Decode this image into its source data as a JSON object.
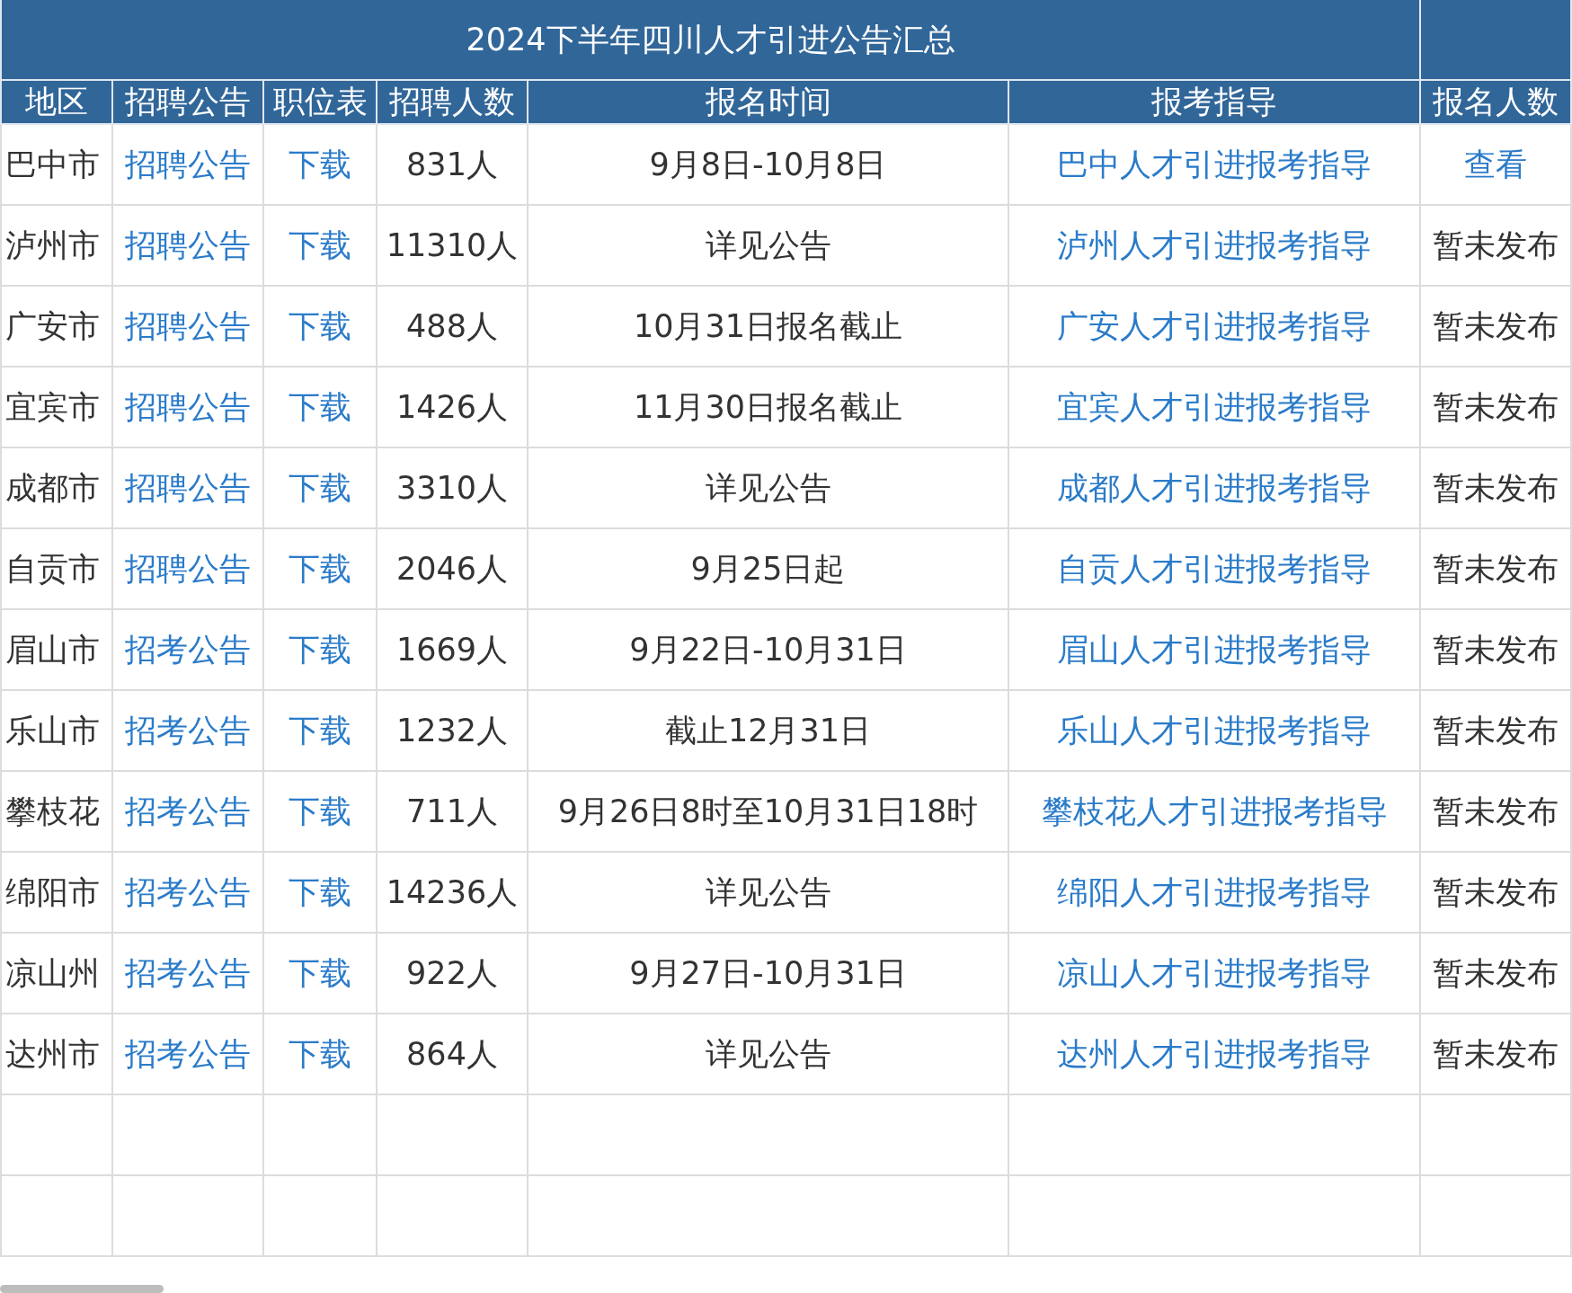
{
  "title": "2024下半年四川人才引进公告汇总",
  "columns": [
    "地区",
    "招聘公告",
    "职位表",
    "招聘人数",
    "报名时间",
    "报考指导",
    "报名人数"
  ],
  "rows": [
    {
      "region": "巴中市",
      "notice": "招聘公告",
      "positions": "下载",
      "count": "831人",
      "period": "9月8日-10月8日",
      "guide": "巴中人才引进报考指导",
      "applicants": {
        "kind": "link",
        "text": "查看"
      }
    },
    {
      "region": "泸州市",
      "notice": "招聘公告",
      "positions": "下载",
      "count": "11310人",
      "period": "详见公告",
      "guide": "泸州人才引进报考指导",
      "applicants": {
        "kind": "text",
        "text": "暂未发布"
      }
    },
    {
      "region": "广安市",
      "notice": "招聘公告",
      "positions": "下载",
      "count": "488人",
      "period": "10月31日报名截止",
      "guide": "广安人才引进报考指导",
      "applicants": {
        "kind": "text",
        "text": "暂未发布"
      }
    },
    {
      "region": "宜宾市",
      "notice": "招聘公告",
      "positions": "下载",
      "count": "1426人",
      "period": "11月30日报名截止",
      "guide": "宜宾人才引进报考指导",
      "applicants": {
        "kind": "text",
        "text": "暂未发布"
      }
    },
    {
      "region": "成都市",
      "notice": "招聘公告",
      "positions": "下载",
      "count": "3310人",
      "period": "详见公告",
      "guide": "成都人才引进报考指导",
      "applicants": {
        "kind": "text",
        "text": "暂未发布"
      }
    },
    {
      "region": "自贡市",
      "notice": "招聘公告",
      "positions": "下载",
      "count": "2046人",
      "period": "9月25日起",
      "guide": "自贡人才引进报考指导",
      "applicants": {
        "kind": "text",
        "text": "暂未发布"
      }
    },
    {
      "region": "眉山市",
      "notice": "招考公告",
      "positions": "下载",
      "count": "1669人",
      "period": "9月22日-10月31日",
      "guide": "眉山人才引进报考指导",
      "applicants": {
        "kind": "text",
        "text": "暂未发布"
      }
    },
    {
      "region": "乐山市",
      "notice": "招考公告",
      "positions": "下载",
      "count": "1232人",
      "period": "截止12月31日",
      "guide": "乐山人才引进报考指导",
      "applicants": {
        "kind": "text",
        "text": "暂未发布"
      }
    },
    {
      "region": "攀枝花",
      "notice": "招考公告",
      "positions": "下载",
      "count": "711人",
      "period": "9月26日8时至10月31日18时",
      "guide": "攀枝花人才引进报考指导",
      "applicants": {
        "kind": "text",
        "text": "暂未发布"
      }
    },
    {
      "region": "绵阳市",
      "notice": "招考公告",
      "positions": "下载",
      "count": "14236人",
      "period": "详见公告",
      "guide": "绵阳人才引进报考指导",
      "applicants": {
        "kind": "text",
        "text": "暂未发布"
      }
    },
    {
      "region": "凉山州",
      "notice": "招考公告",
      "positions": "下载",
      "count": "922人",
      "period": "9月27日-10月31日",
      "guide": "凉山人才引进报考指导",
      "applicants": {
        "kind": "text",
        "text": "暂未发布"
      }
    },
    {
      "region": "达州市",
      "notice": "招考公告",
      "positions": "下载",
      "count": "864人",
      "period": "详见公告",
      "guide": "达州人才引进报考指导",
      "applicants": {
        "kind": "text",
        "text": "暂未发布"
      }
    }
  ]
}
